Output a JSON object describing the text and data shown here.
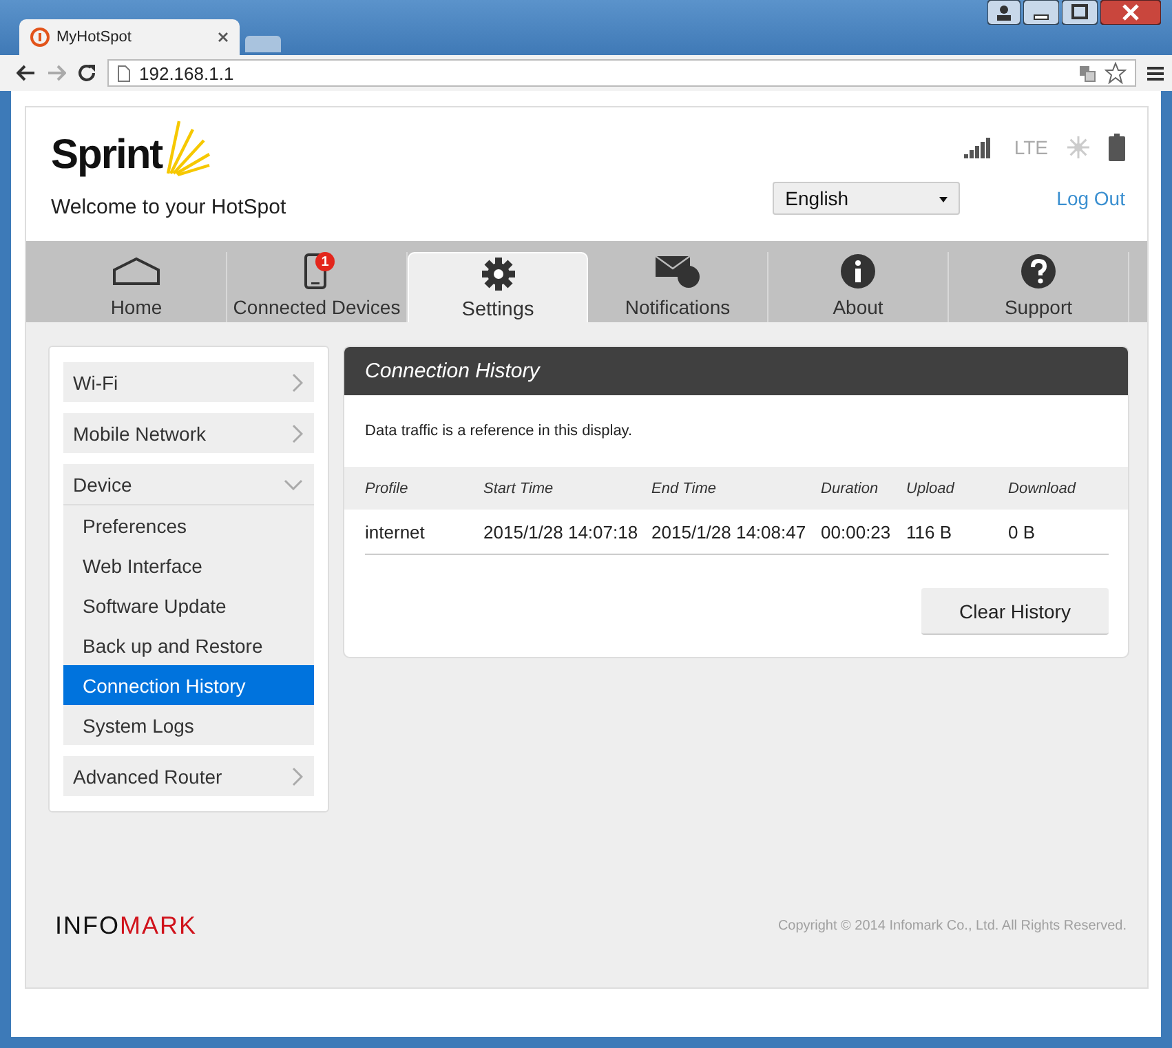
{
  "browser": {
    "tab_title": "MyHotSpot",
    "address": "192.168.1.1"
  },
  "header": {
    "brand": "Sprint",
    "welcome": "Welcome to your HotSpot",
    "network": "LTE",
    "language": "English",
    "logout": "Log Out"
  },
  "tabs": [
    {
      "kind": "home",
      "label": "Home",
      "selected": false
    },
    {
      "kind": "phone",
      "label": "Connected Devices",
      "badge": "1",
      "selected": false
    },
    {
      "kind": "gear",
      "label": "Settings",
      "selected": true
    },
    {
      "kind": "mail",
      "label": "Notifications",
      "selected": false
    },
    {
      "kind": "info",
      "label": "About",
      "selected": false
    },
    {
      "kind": "help",
      "label": "Support",
      "selected": false
    }
  ],
  "sidebar": {
    "items": [
      {
        "label": "Wi-Fi",
        "expanded": false
      },
      {
        "label": "Mobile Network",
        "expanded": false
      },
      {
        "label": "Device",
        "expanded": true,
        "children": [
          {
            "label": "Preferences",
            "selected": false
          },
          {
            "label": "Web Interface",
            "selected": false
          },
          {
            "label": "Software Update",
            "selected": false
          },
          {
            "label": "Back up and Restore",
            "selected": false
          },
          {
            "label": "Connection History",
            "selected": true
          },
          {
            "label": "System Logs",
            "selected": false
          }
        ]
      },
      {
        "label": "Advanced Router",
        "expanded": false
      }
    ]
  },
  "panel": {
    "title": "Connection History",
    "note": "Data traffic is a reference in this display.",
    "table": {
      "columns": [
        "Profile",
        "Start Time",
        "End Time",
        "Duration",
        "Upload",
        "Download"
      ],
      "rows": [
        [
          "internet",
          "2015/1/28 14:07:18",
          "2015/1/28 14:08:47",
          "00:00:23",
          "116 B",
          "0 B"
        ]
      ]
    },
    "button": "Clear History"
  },
  "footer": {
    "logo_parts": [
      {
        "text": "INFO",
        "color": "#111111"
      },
      {
        "text": "MARK",
        "color": "#d0121b"
      }
    ],
    "copyright": "Copyright © 2014 Infomark Co., Ltd. All Rights Reserved."
  }
}
